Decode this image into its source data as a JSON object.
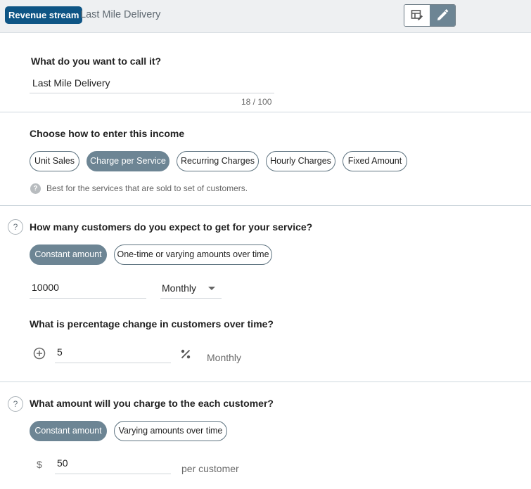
{
  "header": {
    "badge": "Revenue stream",
    "title": "Last Mile Delivery",
    "table_view_icon": "table-edit-icon",
    "edit_icon": "pencil-icon"
  },
  "name_section": {
    "label": "What do you want to call it?",
    "value": "Last Mile Delivery",
    "counter": "18 / 100"
  },
  "income_section": {
    "label": "Choose how to enter this income",
    "options": [
      "Unit Sales",
      "Charge per Service",
      "Recurring Charges",
      "Hourly Charges",
      "Fixed Amount"
    ],
    "selected": "Charge per Service",
    "hint": "Best for the services that are sold to set of customers."
  },
  "customers_section": {
    "help": "?",
    "label": "How many customers do you expect to get for your service?",
    "options": [
      "Constant amount",
      "One-time or varying amounts over time"
    ],
    "selected": "Constant amount",
    "value": "10000",
    "frequency": "Monthly",
    "change_label": "What is percentage change in customers over time?",
    "change_value": "5",
    "change_unit_icon": "percent-icon",
    "change_frequency": "Monthly"
  },
  "charge_section": {
    "help": "?",
    "label": "What amount will you charge to the each customer?",
    "options": [
      "Constant amount",
      "Varying amounts over time"
    ],
    "selected": "Constant amount",
    "currency": "$",
    "value": "50",
    "unit": "per customer"
  },
  "colors": {
    "brand": "#0e5585",
    "chip_active": "#6d8594",
    "divider": "#cfd8de"
  }
}
